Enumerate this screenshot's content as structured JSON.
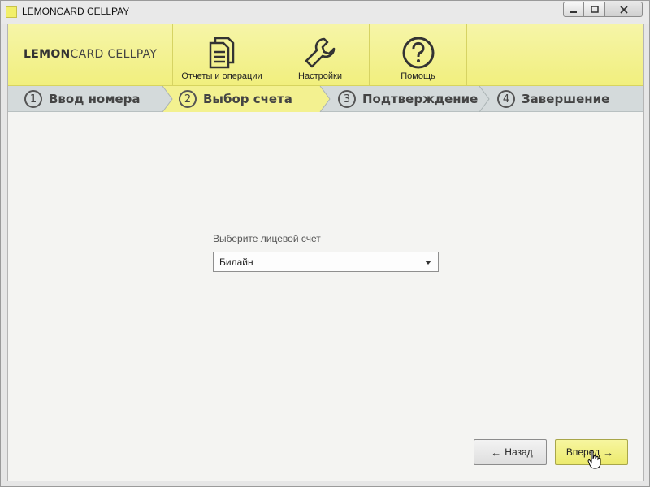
{
  "window": {
    "title": "LEMONCARD CELLPAY",
    "controls": {
      "minimize": "▁",
      "maximize": "▢",
      "close": "✕"
    }
  },
  "header": {
    "brand_bold": "LEMON",
    "brand_rest": "CARD CELLPAY",
    "buttons": [
      {
        "label": "Отчеты и операции",
        "icon": "documents-icon"
      },
      {
        "label": "Настройки",
        "icon": "wrench-icon"
      },
      {
        "label": "Помощь",
        "icon": "help-icon"
      }
    ]
  },
  "steps": [
    {
      "num": "1",
      "label": "Ввод номера",
      "active": false
    },
    {
      "num": "2",
      "label": "Выбор счета",
      "active": true
    },
    {
      "num": "3",
      "label": "Подтверждение",
      "active": false
    },
    {
      "num": "4",
      "label": "Завершение",
      "active": false
    }
  ],
  "form": {
    "account_label": "Выберите лицевой счет",
    "account_value": "Билайн"
  },
  "nav": {
    "back_label": "Назад",
    "next_label": "Вперед",
    "back_arrow": "←",
    "next_arrow": "→"
  },
  "colors": {
    "accent": "#f1ef7e",
    "active_step": "#f3f190",
    "steps_bar": "#d4dadb"
  }
}
